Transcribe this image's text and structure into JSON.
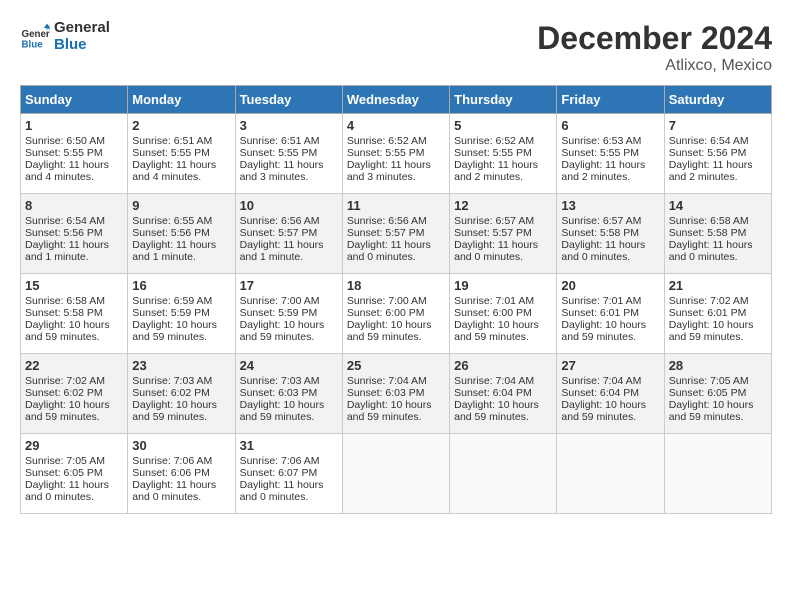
{
  "logo": {
    "line1": "General",
    "line2": "Blue"
  },
  "header": {
    "month": "December 2024",
    "location": "Atlixco, Mexico"
  },
  "weekdays": [
    "Sunday",
    "Monday",
    "Tuesday",
    "Wednesday",
    "Thursday",
    "Friday",
    "Saturday"
  ],
  "weeks": [
    [
      {
        "day": 1,
        "lines": [
          "Sunrise: 6:50 AM",
          "Sunset: 5:55 PM",
          "Daylight: 11 hours",
          "and 4 minutes."
        ]
      },
      {
        "day": 2,
        "lines": [
          "Sunrise: 6:51 AM",
          "Sunset: 5:55 PM",
          "Daylight: 11 hours",
          "and 4 minutes."
        ]
      },
      {
        "day": 3,
        "lines": [
          "Sunrise: 6:51 AM",
          "Sunset: 5:55 PM",
          "Daylight: 11 hours",
          "and 3 minutes."
        ]
      },
      {
        "day": 4,
        "lines": [
          "Sunrise: 6:52 AM",
          "Sunset: 5:55 PM",
          "Daylight: 11 hours",
          "and 3 minutes."
        ]
      },
      {
        "day": 5,
        "lines": [
          "Sunrise: 6:52 AM",
          "Sunset: 5:55 PM",
          "Daylight: 11 hours",
          "and 2 minutes."
        ]
      },
      {
        "day": 6,
        "lines": [
          "Sunrise: 6:53 AM",
          "Sunset: 5:55 PM",
          "Daylight: 11 hours",
          "and 2 minutes."
        ]
      },
      {
        "day": 7,
        "lines": [
          "Sunrise: 6:54 AM",
          "Sunset: 5:56 PM",
          "Daylight: 11 hours",
          "and 2 minutes."
        ]
      }
    ],
    [
      {
        "day": 8,
        "lines": [
          "Sunrise: 6:54 AM",
          "Sunset: 5:56 PM",
          "Daylight: 11 hours",
          "and 1 minute."
        ]
      },
      {
        "day": 9,
        "lines": [
          "Sunrise: 6:55 AM",
          "Sunset: 5:56 PM",
          "Daylight: 11 hours",
          "and 1 minute."
        ]
      },
      {
        "day": 10,
        "lines": [
          "Sunrise: 6:56 AM",
          "Sunset: 5:57 PM",
          "Daylight: 11 hours",
          "and 1 minute."
        ]
      },
      {
        "day": 11,
        "lines": [
          "Sunrise: 6:56 AM",
          "Sunset: 5:57 PM",
          "Daylight: 11 hours",
          "and 0 minutes."
        ]
      },
      {
        "day": 12,
        "lines": [
          "Sunrise: 6:57 AM",
          "Sunset: 5:57 PM",
          "Daylight: 11 hours",
          "and 0 minutes."
        ]
      },
      {
        "day": 13,
        "lines": [
          "Sunrise: 6:57 AM",
          "Sunset: 5:58 PM",
          "Daylight: 11 hours",
          "and 0 minutes."
        ]
      },
      {
        "day": 14,
        "lines": [
          "Sunrise: 6:58 AM",
          "Sunset: 5:58 PM",
          "Daylight: 11 hours",
          "and 0 minutes."
        ]
      }
    ],
    [
      {
        "day": 15,
        "lines": [
          "Sunrise: 6:58 AM",
          "Sunset: 5:58 PM",
          "Daylight: 10 hours",
          "and 59 minutes."
        ]
      },
      {
        "day": 16,
        "lines": [
          "Sunrise: 6:59 AM",
          "Sunset: 5:59 PM",
          "Daylight: 10 hours",
          "and 59 minutes."
        ]
      },
      {
        "day": 17,
        "lines": [
          "Sunrise: 7:00 AM",
          "Sunset: 5:59 PM",
          "Daylight: 10 hours",
          "and 59 minutes."
        ]
      },
      {
        "day": 18,
        "lines": [
          "Sunrise: 7:00 AM",
          "Sunset: 6:00 PM",
          "Daylight: 10 hours",
          "and 59 minutes."
        ]
      },
      {
        "day": 19,
        "lines": [
          "Sunrise: 7:01 AM",
          "Sunset: 6:00 PM",
          "Daylight: 10 hours",
          "and 59 minutes."
        ]
      },
      {
        "day": 20,
        "lines": [
          "Sunrise: 7:01 AM",
          "Sunset: 6:01 PM",
          "Daylight: 10 hours",
          "and 59 minutes."
        ]
      },
      {
        "day": 21,
        "lines": [
          "Sunrise: 7:02 AM",
          "Sunset: 6:01 PM",
          "Daylight: 10 hours",
          "and 59 minutes."
        ]
      }
    ],
    [
      {
        "day": 22,
        "lines": [
          "Sunrise: 7:02 AM",
          "Sunset: 6:02 PM",
          "Daylight: 10 hours",
          "and 59 minutes."
        ]
      },
      {
        "day": 23,
        "lines": [
          "Sunrise: 7:03 AM",
          "Sunset: 6:02 PM",
          "Daylight: 10 hours",
          "and 59 minutes."
        ]
      },
      {
        "day": 24,
        "lines": [
          "Sunrise: 7:03 AM",
          "Sunset: 6:03 PM",
          "Daylight: 10 hours",
          "and 59 minutes."
        ]
      },
      {
        "day": 25,
        "lines": [
          "Sunrise: 7:04 AM",
          "Sunset: 6:03 PM",
          "Daylight: 10 hours",
          "and 59 minutes."
        ]
      },
      {
        "day": 26,
        "lines": [
          "Sunrise: 7:04 AM",
          "Sunset: 6:04 PM",
          "Daylight: 10 hours",
          "and 59 minutes."
        ]
      },
      {
        "day": 27,
        "lines": [
          "Sunrise: 7:04 AM",
          "Sunset: 6:04 PM",
          "Daylight: 10 hours",
          "and 59 minutes."
        ]
      },
      {
        "day": 28,
        "lines": [
          "Sunrise: 7:05 AM",
          "Sunset: 6:05 PM",
          "Daylight: 10 hours",
          "and 59 minutes."
        ]
      }
    ],
    [
      {
        "day": 29,
        "lines": [
          "Sunrise: 7:05 AM",
          "Sunset: 6:05 PM",
          "Daylight: 11 hours",
          "and 0 minutes."
        ]
      },
      {
        "day": 30,
        "lines": [
          "Sunrise: 7:06 AM",
          "Sunset: 6:06 PM",
          "Daylight: 11 hours",
          "and 0 minutes."
        ]
      },
      {
        "day": 31,
        "lines": [
          "Sunrise: 7:06 AM",
          "Sunset: 6:07 PM",
          "Daylight: 11 hours",
          "and 0 minutes."
        ]
      },
      null,
      null,
      null,
      null
    ]
  ]
}
